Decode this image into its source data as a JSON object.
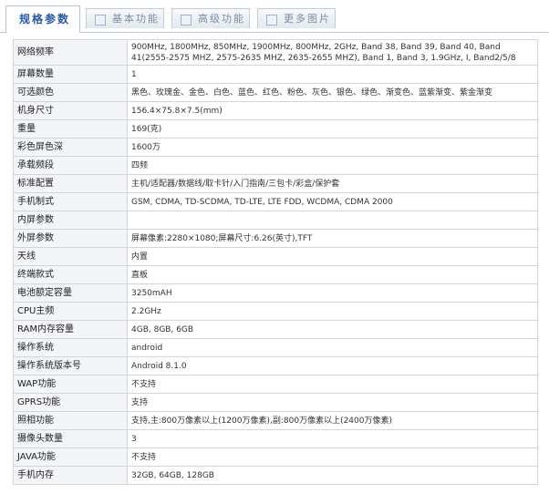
{
  "tabs": [
    {
      "label": "规格参数",
      "active": true
    },
    {
      "label": "基本功能",
      "active": false
    },
    {
      "label": "高级功能",
      "active": false
    },
    {
      "label": "更多图片",
      "active": false
    }
  ],
  "specs": [
    {
      "key": "网络频率",
      "value": "900MHz, 1800MHz, 850MHz, 1900MHz, 800MHz, 2GHz, Band 38, Band 39, Band 40, Band 41(2555-2575 MHZ, 2575-2635 MHZ, 2635-2655 MHZ), Band 1, Band 3, 1.9GHz, I, Band2/5/8"
    },
    {
      "key": "屏幕数量",
      "value": "1"
    },
    {
      "key": "可选颜色",
      "value": "黑色、玫瑰金、金色、白色、蓝色、红色、粉色、灰色、银色、绿色、渐变色、蓝紫渐变、紫金渐变"
    },
    {
      "key": "机身尺寸",
      "value": "156.4×75.8×7.5(mm)"
    },
    {
      "key": "重量",
      "value": "169(克)"
    },
    {
      "key": "彩色屏色深",
      "value": "1600万"
    },
    {
      "key": "承载频段",
      "value": "四频"
    },
    {
      "key": "标准配置",
      "value": "主机/适配器/数据线/取卡针/入门指南/三包卡/彩盒/保护套"
    },
    {
      "key": "手机制式",
      "value": "GSM, CDMA, TD-SCDMA, TD-LTE, LTE FDD, WCDMA, CDMA 2000"
    },
    {
      "key": "内屏参数",
      "value": ""
    },
    {
      "key": "外屏参数",
      "value": "屏幕像素:2280×1080;屏幕尺寸:6.26(英寸),TFT"
    },
    {
      "key": "天线",
      "value": "内置"
    },
    {
      "key": "终端款式",
      "value": "直板"
    },
    {
      "key": "电池额定容量",
      "value": "3250mAH"
    },
    {
      "key": "CPU主频",
      "value": "2.2GHz"
    },
    {
      "key": "RAM内存容量",
      "value": "4GB, 8GB, 6GB"
    },
    {
      "key": "操作系统",
      "value": "android"
    },
    {
      "key": "操作系统版本号",
      "value": "Android 8.1.0"
    },
    {
      "key": "WAP功能",
      "value": "不支持"
    },
    {
      "key": "GPRS功能",
      "value": "支持"
    },
    {
      "key": "照相功能",
      "value": "支持,主:800万像素以上(1200万像素),副:800万像素以上(2400万像素)"
    },
    {
      "key": "摄像头数量",
      "value": "3"
    },
    {
      "key": "JAVA功能",
      "value": "不支持"
    },
    {
      "key": "手机内存",
      "value": "32GB, 64GB, 128GB"
    }
  ]
}
